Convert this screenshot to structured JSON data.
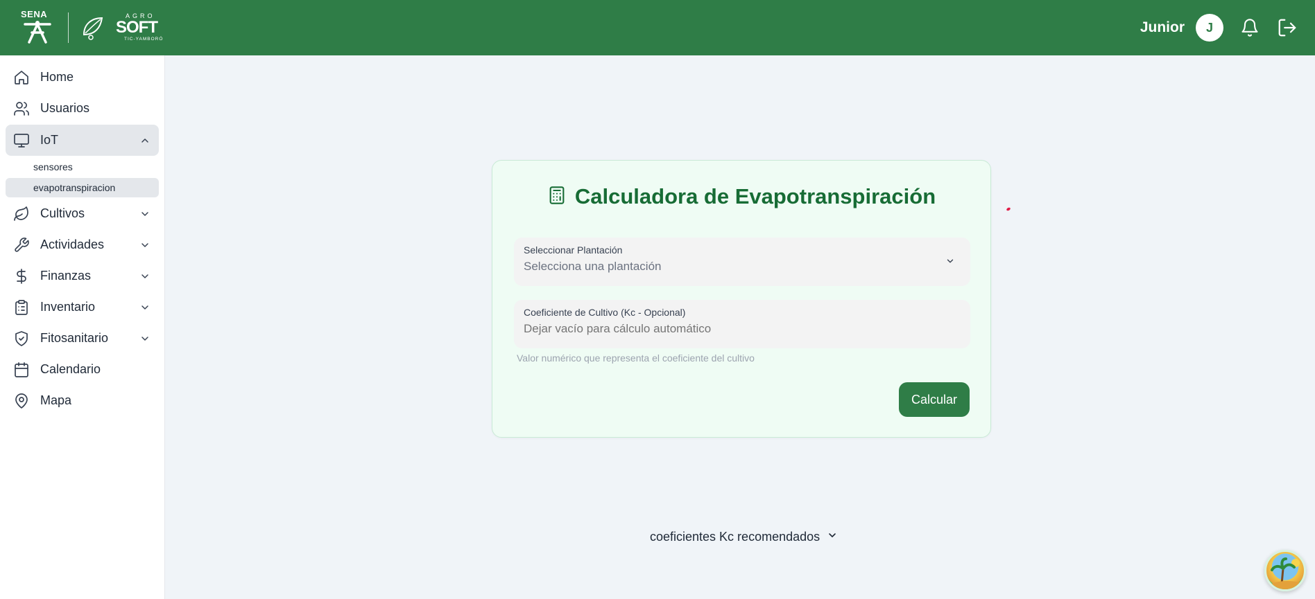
{
  "header": {
    "logo_sena": "SENA",
    "logo_agro": "AGRO",
    "logo_soft": "SOFT",
    "logo_sub": "TIC-YAMBORÓ",
    "username": "Junior",
    "avatar_initial": "J",
    "bar_color": "#2f7d47"
  },
  "sidebar": {
    "items": [
      {
        "label": "Home",
        "icon": "home-icon"
      },
      {
        "label": "Usuarios",
        "icon": "users-icon"
      },
      {
        "label": "IoT",
        "icon": "monitor-icon",
        "expanded": true
      },
      {
        "label": "Cultivos",
        "icon": "leaf-icon"
      },
      {
        "label": "Actividades",
        "icon": "wrench-icon"
      },
      {
        "label": "Finanzas",
        "icon": "dollar-icon"
      },
      {
        "label": "Inventario",
        "icon": "clipboard-icon"
      },
      {
        "label": "Fitosanitario",
        "icon": "shield-check-icon"
      },
      {
        "label": "Calendario",
        "icon": "calendar-icon"
      },
      {
        "label": "Mapa",
        "icon": "map-pin-icon"
      }
    ],
    "iot_sub": [
      {
        "label": "sensores"
      },
      {
        "label": "evapotranspiracion",
        "active": true
      }
    ]
  },
  "main": {
    "title": "Calculadora de Evapotranspiración",
    "plantacion_label": "Seleccionar Plantación",
    "plantacion_placeholder": "Selecciona una plantación",
    "kc_label": "Coeficiente de Cultivo (Kc - Opcional)",
    "kc_placeholder": "Dejar vacío para cálculo automático",
    "kc_hint": "Valor numérico que representa el coeficiente del cultivo",
    "calc_button": "Calcular",
    "kc_toggle": "coeficientes Kc recomendados",
    "accent_color": "#176c35"
  }
}
